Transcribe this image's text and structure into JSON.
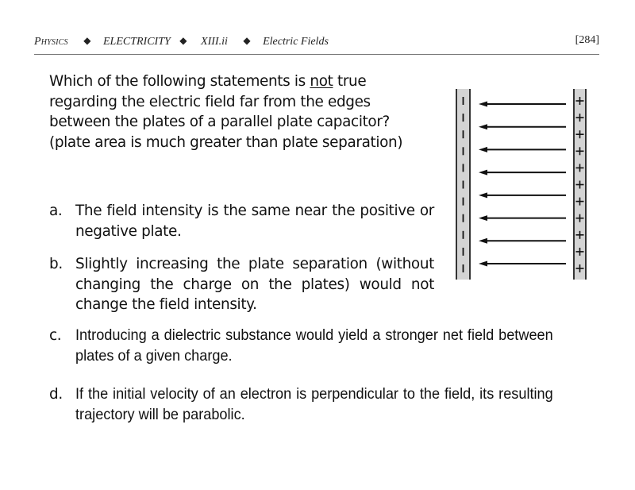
{
  "header": {
    "subject": "Physics",
    "topic": "ELECTRICITY",
    "section": "XIII.ii",
    "subtopic": "Electric Fields",
    "separator": "◆",
    "page_number": "[284]"
  },
  "question": {
    "text_before": "Which of the following statements is ",
    "emphasis": "not",
    "text_after": " true regarding the electric field far from the edges between the plates of a parallel plate capacitor?  (plate area is much greater than plate separation)"
  },
  "options": [
    {
      "letter": "a.",
      "text": "The field intensity is the same near the positive or negative plate."
    },
    {
      "letter": "b.",
      "text": "Slightly increasing the plate separation (without changing the charge on the plates) would not change the field intensity."
    },
    {
      "letter": "c.",
      "text": "Introducing a dielectric substance would yield a stronger net field between plates of a given charge."
    },
    {
      "letter": "d.",
      "text": "If the initial velocity of an electron is perpendicular to the field, its resulting trajectory will be parabolic."
    }
  ],
  "diagram": {
    "description": "parallel-plate-capacitor",
    "negative_plate": {
      "side": "left",
      "symbol": "−",
      "charge_count": 11
    },
    "positive_plate": {
      "side": "right",
      "symbol": "+",
      "charge_count": 11
    },
    "field_lines": {
      "count": 8,
      "direction": "right-to-left"
    },
    "colors": {
      "plate_fill": "#d4d4d4",
      "plate_border": "#333333",
      "arrow": "#111111"
    }
  }
}
